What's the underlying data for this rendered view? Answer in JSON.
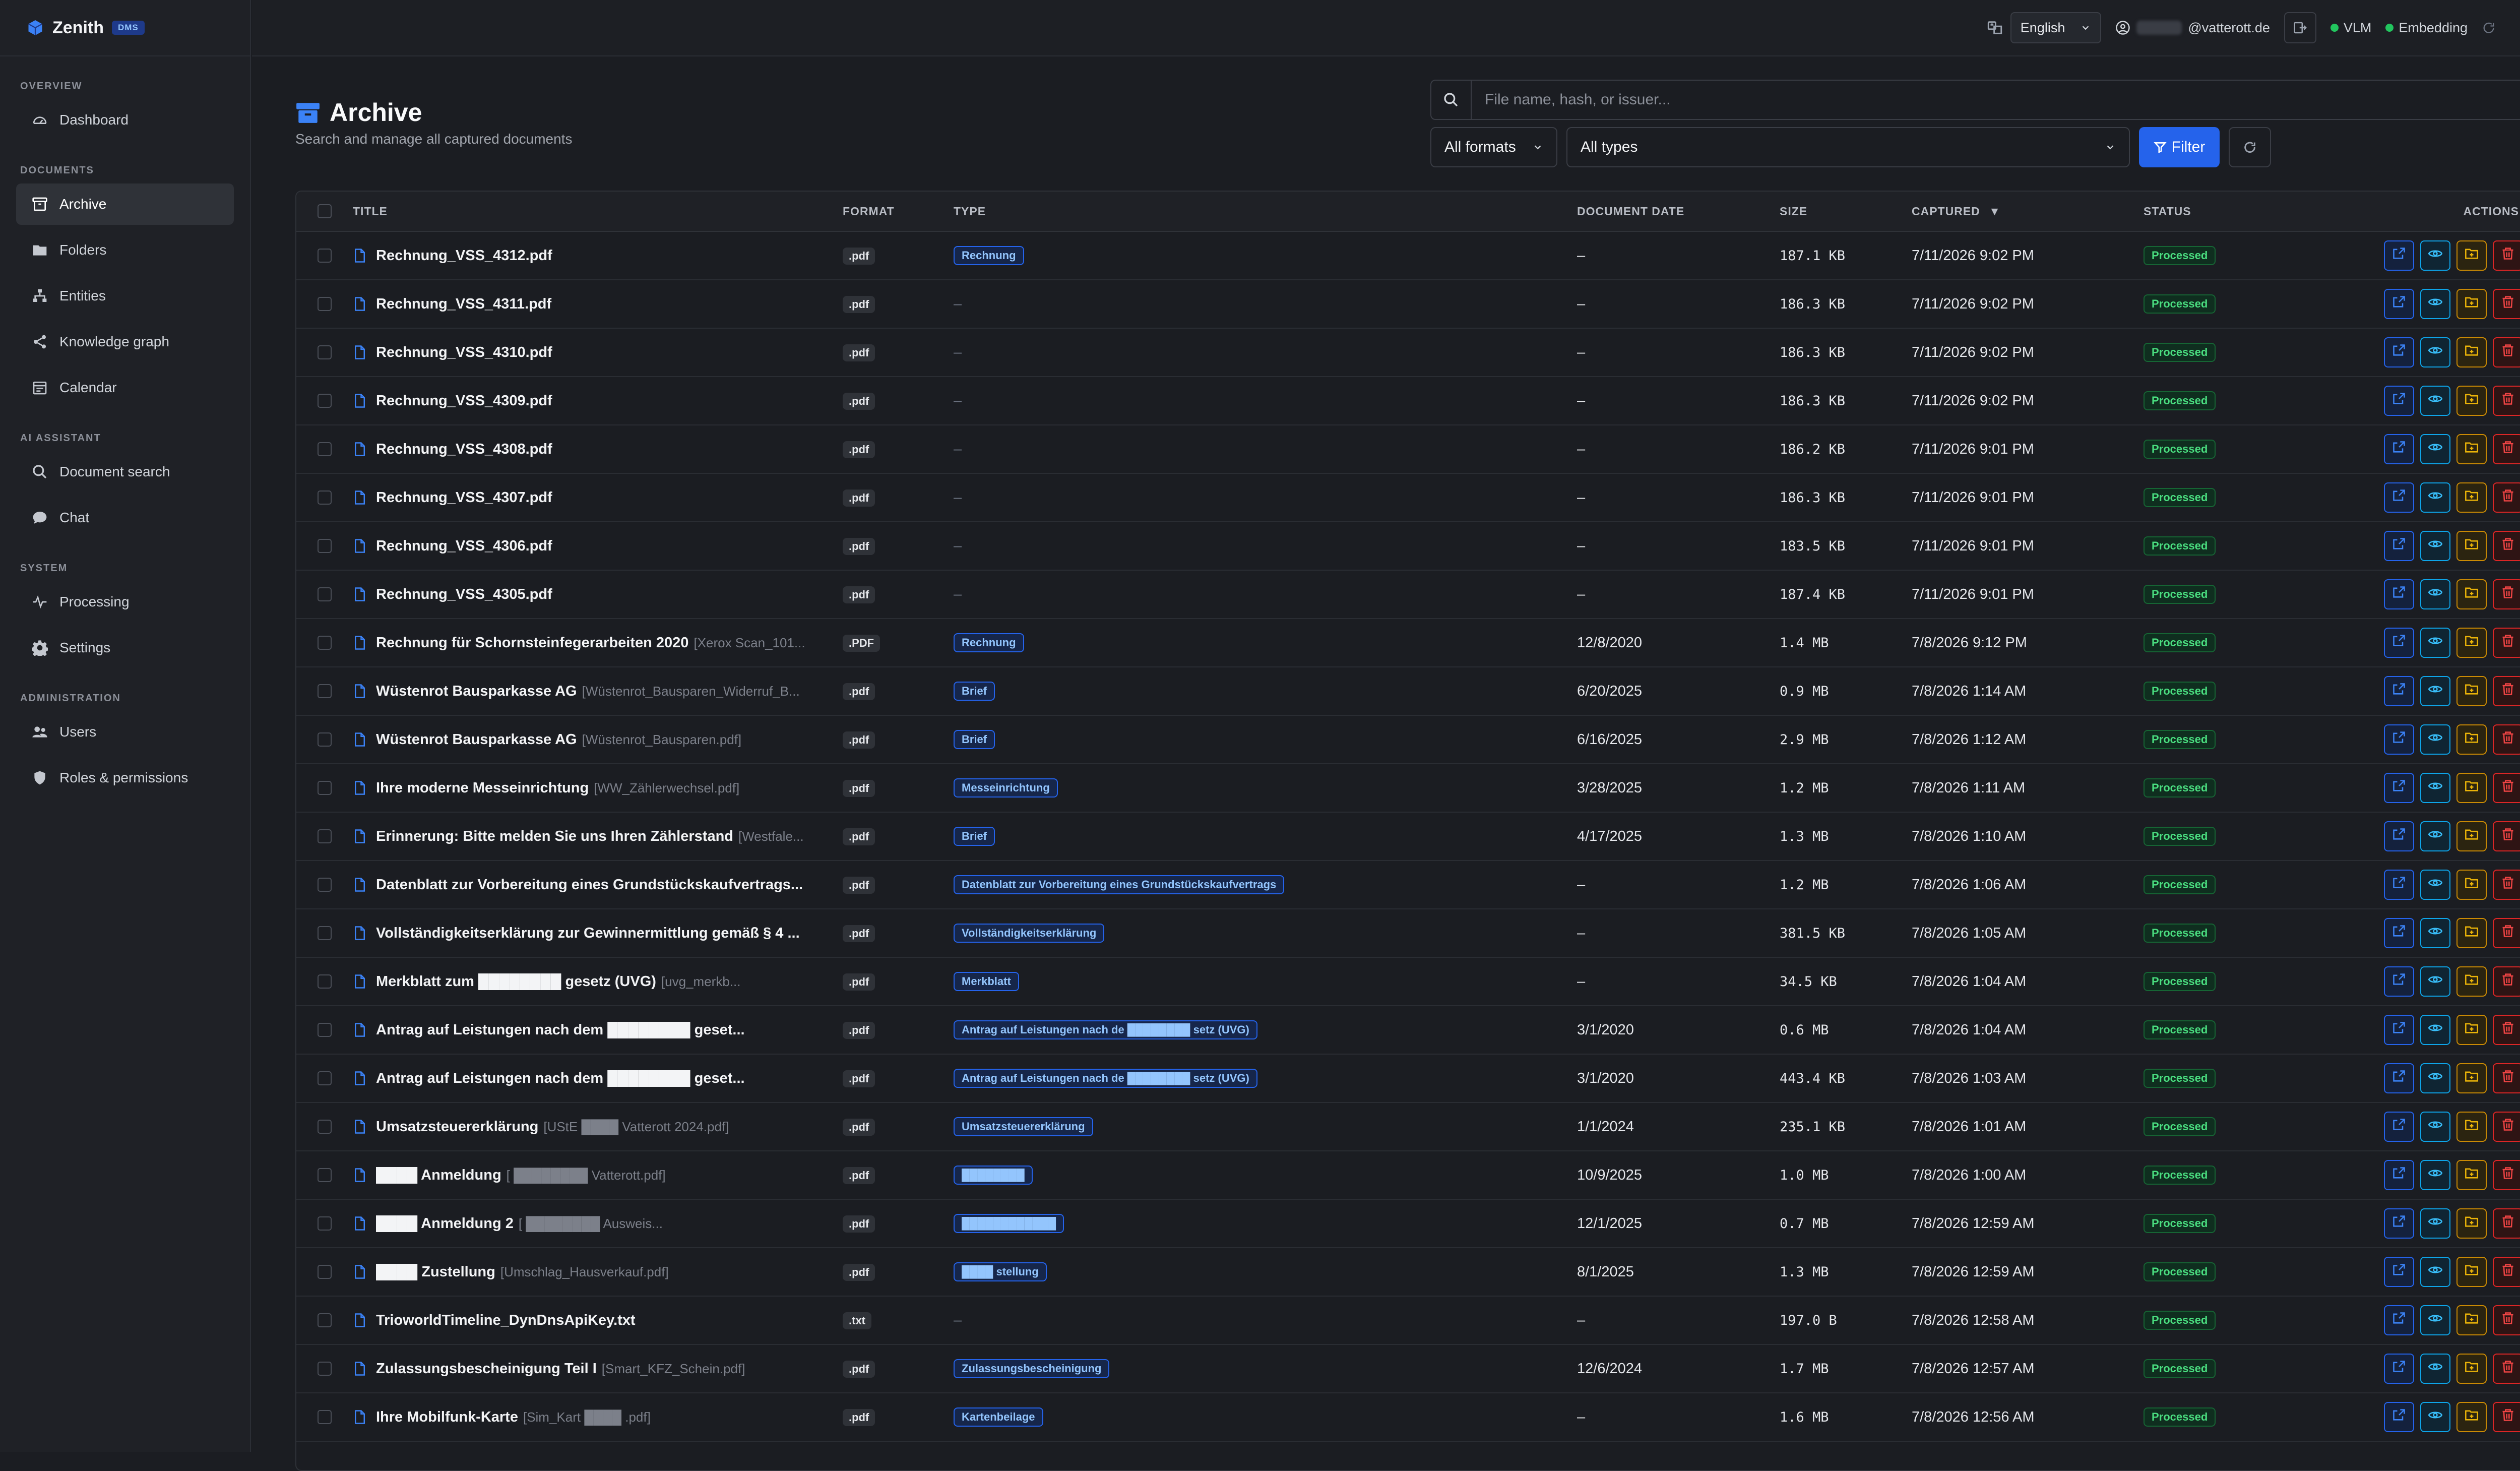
{
  "brand": {
    "name": "Zenith",
    "badge": "DMS"
  },
  "sidebar": {
    "sections": [
      {
        "label": "OVERVIEW",
        "items": [
          {
            "label": "Dashboard",
            "icon": "gauge-icon"
          }
        ]
      },
      {
        "label": "DOCUMENTS",
        "items": [
          {
            "label": "Archive",
            "icon": "archive-icon",
            "active": true
          },
          {
            "label": "Folders",
            "icon": "folder-icon"
          },
          {
            "label": "Entities",
            "icon": "hierarchy-icon"
          },
          {
            "label": "Knowledge graph",
            "icon": "share-icon"
          },
          {
            "label": "Calendar",
            "icon": "calendar-icon"
          }
        ]
      },
      {
        "label": "AI ASSISTANT",
        "items": [
          {
            "label": "Document search",
            "icon": "search-icon"
          },
          {
            "label": "Chat",
            "icon": "chat-icon"
          }
        ]
      },
      {
        "label": "SYSTEM",
        "items": [
          {
            "label": "Processing",
            "icon": "activity-icon"
          },
          {
            "label": "Settings",
            "icon": "gear-icon"
          }
        ]
      },
      {
        "label": "ADMINISTRATION",
        "items": [
          {
            "label": "Users",
            "icon": "users-icon"
          },
          {
            "label": "Roles & permissions",
            "icon": "shield-icon"
          }
        ]
      }
    ]
  },
  "topbar": {
    "language": "English",
    "user_email_domain": "@vatterott.de",
    "status_vlm": "VLM",
    "status_embedding": "Embedding"
  },
  "page": {
    "title": "Archive",
    "subtitle": "Search and manage all captured documents",
    "search_placeholder": "File name, hash, or issuer...",
    "format_filter": "All formats",
    "type_filter": "All types",
    "filter_button": "Filter"
  },
  "table": {
    "headers": {
      "title": "TITLE",
      "format": "FORMAT",
      "type": "TYPE",
      "document_date": "DOCUMENT DATE",
      "size": "SIZE",
      "captured": "CAPTURED",
      "status": "STATUS",
      "actions": "ACTIONS"
    },
    "rows": [
      {
        "title": "Rechnung_VSS_4312.pdf",
        "fname": "",
        "format": ".pdf",
        "type": "Rechnung",
        "date": "–",
        "size": "187.1 KB",
        "captured": "7/11/2026 9:02 PM",
        "status": "Processed"
      },
      {
        "title": "Rechnung_VSS_4311.pdf",
        "fname": "",
        "format": ".pdf",
        "type": "",
        "date": "–",
        "size": "186.3 KB",
        "captured": "7/11/2026 9:02 PM",
        "status": "Processed"
      },
      {
        "title": "Rechnung_VSS_4310.pdf",
        "fname": "",
        "format": ".pdf",
        "type": "",
        "date": "–",
        "size": "186.3 KB",
        "captured": "7/11/2026 9:02 PM",
        "status": "Processed"
      },
      {
        "title": "Rechnung_VSS_4309.pdf",
        "fname": "",
        "format": ".pdf",
        "type": "",
        "date": "–",
        "size": "186.3 KB",
        "captured": "7/11/2026 9:02 PM",
        "status": "Processed"
      },
      {
        "title": "Rechnung_VSS_4308.pdf",
        "fname": "",
        "format": ".pdf",
        "type": "",
        "date": "–",
        "size": "186.2 KB",
        "captured": "7/11/2026 9:01 PM",
        "status": "Processed"
      },
      {
        "title": "Rechnung_VSS_4307.pdf",
        "fname": "",
        "format": ".pdf",
        "type": "",
        "date": "–",
        "size": "186.3 KB",
        "captured": "7/11/2026 9:01 PM",
        "status": "Processed"
      },
      {
        "title": "Rechnung_VSS_4306.pdf",
        "fname": "",
        "format": ".pdf",
        "type": "",
        "date": "–",
        "size": "183.5 KB",
        "captured": "7/11/2026 9:01 PM",
        "status": "Processed"
      },
      {
        "title": "Rechnung_VSS_4305.pdf",
        "fname": "",
        "format": ".pdf",
        "type": "",
        "date": "–",
        "size": "187.4 KB",
        "captured": "7/11/2026 9:01 PM",
        "status": "Processed"
      },
      {
        "title": "Rechnung für Schornsteinfegerarbeiten 2020",
        "fname": "[Xerox Scan_101...",
        "format": ".PDF",
        "type": "Rechnung",
        "date": "12/8/2020",
        "size": "1.4 MB",
        "captured": "7/8/2026 9:12 PM",
        "status": "Processed"
      },
      {
        "title": "Wüstenrot Bausparkasse AG",
        "fname": "[Wüstenrot_Bausparen_Widerruf_B...",
        "format": ".pdf",
        "type": "Brief",
        "date": "6/20/2025",
        "size": "0.9 MB",
        "captured": "7/8/2026 1:14 AM",
        "status": "Processed"
      },
      {
        "title": "Wüstenrot Bausparkasse AG",
        "fname": "[Wüstenrot_Bausparen.pdf]",
        "format": ".pdf",
        "type": "Brief",
        "date": "6/16/2025",
        "size": "2.9 MB",
        "captured": "7/8/2026 1:12 AM",
        "status": "Processed"
      },
      {
        "title": "Ihre moderne Messeinrichtung",
        "fname": "[WW_Zählerwechsel.pdf]",
        "format": ".pdf",
        "type": "Messeinrichtung",
        "date": "3/28/2025",
        "size": "1.2 MB",
        "captured": "7/8/2026 1:11 AM",
        "status": "Processed"
      },
      {
        "title": "Erinnerung: Bitte melden Sie uns Ihren Zählerstand",
        "fname": "[Westfale...",
        "format": ".pdf",
        "type": "Brief",
        "date": "4/17/2025",
        "size": "1.3 MB",
        "captured": "7/8/2026 1:10 AM",
        "status": "Processed"
      },
      {
        "title": "Datenblatt zur Vorbereitung eines Grundstückskaufvertrags...",
        "fname": "",
        "format": ".pdf",
        "type": "Datenblatt zur Vorbereitung eines Grundstückskaufvertrags",
        "date": "–",
        "size": "1.2 MB",
        "captured": "7/8/2026 1:06 AM",
        "status": "Processed"
      },
      {
        "title": "Vollständigkeitserklärung zur Gewinnermittlung gemäß § 4 ...",
        "fname": "",
        "format": ".pdf",
        "type": "Vollständigkeitserklärung",
        "date": "–",
        "size": "381.5 KB",
        "captured": "7/8/2026 1:05 AM",
        "status": "Processed"
      },
      {
        "title": "Merkblatt zum ████████ gesetz (UVG)",
        "fname": "[uvg_merkb...",
        "format": ".pdf",
        "type": "Merkblatt",
        "date": "–",
        "size": "34.5 KB",
        "captured": "7/8/2026 1:04 AM",
        "status": "Processed"
      },
      {
        "title": "Antrag auf Leistungen nach dem ████████ geset...",
        "fname": "",
        "format": ".pdf",
        "type": "Antrag auf Leistungen nach de ████████ setz (UVG)",
        "date": "3/1/2020",
        "size": "0.6 MB",
        "captured": "7/8/2026 1:04 AM",
        "status": "Processed"
      },
      {
        "title": "Antrag auf Leistungen nach dem ████████ geset...",
        "fname": "",
        "format": ".pdf",
        "type": "Antrag auf Leistungen nach de ████████ setz (UVG)",
        "date": "3/1/2020",
        "size": "443.4 KB",
        "captured": "7/8/2026 1:03 AM",
        "status": "Processed"
      },
      {
        "title": "Umsatzsteuererklärung",
        "fname": "[UStE ████ Vatterott 2024.pdf]",
        "format": ".pdf",
        "type": "Umsatzsteuererklärung",
        "date": "1/1/2024",
        "size": "235.1 KB",
        "captured": "7/8/2026 1:01 AM",
        "status": "Processed"
      },
      {
        "title": "████ Anmeldung",
        "fname": "[ ████████ Vatterott.pdf]",
        "format": ".pdf",
        "type": "████████",
        "date": "10/9/2025",
        "size": "1.0 MB",
        "captured": "7/8/2026 1:00 AM",
        "status": "Processed"
      },
      {
        "title": "████ Anmeldung 2",
        "fname": "[ ████████ Ausweis...",
        "format": ".pdf",
        "type": "████████████",
        "date": "12/1/2025",
        "size": "0.7 MB",
        "captured": "7/8/2026 12:59 AM",
        "status": "Processed"
      },
      {
        "title": "████ Zustellung",
        "fname": "[Umschlag_Hausverkauf.pdf]",
        "format": ".pdf",
        "type": "████ stellung",
        "date": "8/1/2025",
        "size": "1.3 MB",
        "captured": "7/8/2026 12:59 AM",
        "status": "Processed"
      },
      {
        "title": "TrioworldTimeline_DynDnsApiKey.txt",
        "fname": "",
        "format": ".txt",
        "type": "",
        "date": "–",
        "size": "197.0 B",
        "captured": "7/8/2026 12:58 AM",
        "status": "Processed"
      },
      {
        "title": "Zulassungsbescheinigung Teil I",
        "fname": "[Smart_KFZ_Schein.pdf]",
        "format": ".pdf",
        "type": "Zulassungsbescheinigung",
        "date": "12/6/2024",
        "size": "1.7 MB",
        "captured": "7/8/2026 12:57 AM",
        "status": "Processed"
      },
      {
        "title": "Ihre Mobilfunk-Karte",
        "fname": "[Sim_Kart ████ .pdf]",
        "format": ".pdf",
        "type": "Kartenbeilage",
        "date": "–",
        "size": "1.6 MB",
        "captured": "7/8/2026 12:56 AM",
        "status": "Processed"
      }
    ]
  },
  "colors": {
    "accent": "#2563eb",
    "status_green": "#4ade80",
    "danger": "#dc2626",
    "warning": "#ca8a04"
  }
}
